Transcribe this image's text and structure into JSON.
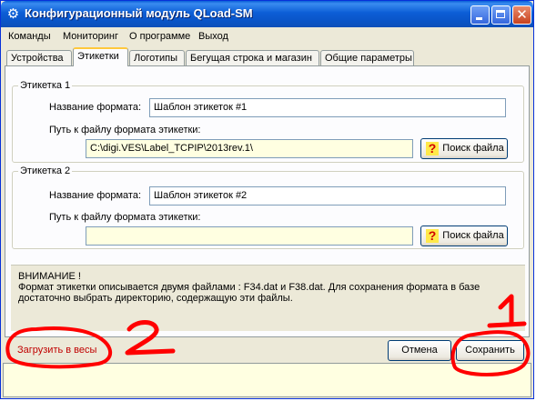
{
  "window": {
    "title": "Конфигурационный модуль QLoad-SM",
    "controls": {
      "minimize": "minimize-icon",
      "maximize": "maximize-icon",
      "close": "close-icon"
    }
  },
  "menu": [
    "Команды",
    "Мониторинг",
    "О программе",
    "Выход"
  ],
  "tabs": [
    "Устройства",
    "Этикетки",
    "Логотипы",
    "Бегущая строка и магазин",
    "Общие параметры"
  ],
  "active_tab": "Этикетки",
  "label1": {
    "group_title": "Этикетка 1",
    "name_label": "Название формата:",
    "name_value": "Шаблон этикеток #1",
    "path_label": "Путь к файлу формата этикетки:",
    "path_value": "C:\\digi.VES\\Label_TCPIP\\2013rev.1\\",
    "browse_button": "Поиск файла"
  },
  "label2": {
    "group_title": "Этикетка 2",
    "name_label": "Название формата:",
    "name_value": "Шаблон этикеток #2",
    "path_label": "Путь к файлу формата этикетки:",
    "path_value": "",
    "browse_button": "Поиск файла"
  },
  "notice": {
    "title": "ВНИМАНИЕ !",
    "line1": "Формат этикетки описывается двумя файлами : F34.dat и F38.dat. Для сохранения формата в базе",
    "line2": "достаточно выбрать директорию, содержащую эти файлы."
  },
  "footer": {
    "upload_link": "Загрузить в весы",
    "cancel_button": "Отмена",
    "save_button": "Сохранить"
  },
  "annotations": {
    "mark1": "1",
    "mark2": "2",
    "color": "#ff0000"
  },
  "colors": {
    "title_bar": "#0a5fd8",
    "window_bg": "#ece9d8",
    "field_yellow": "#ffffe1",
    "accent_tab": "#ffc83c"
  }
}
